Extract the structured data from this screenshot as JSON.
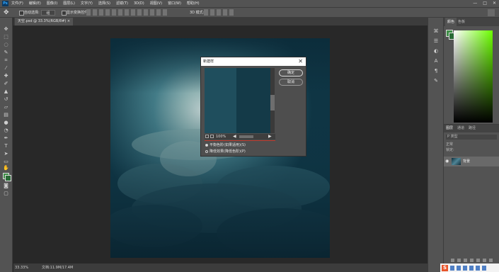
{
  "app": {
    "logo_text": "Ps",
    "menu": [
      "文件(F)",
      "编辑(E)",
      "图像(I)",
      "图层(L)",
      "文字(Y)",
      "选择(S)",
      "滤镜(T)",
      "3D(D)",
      "视图(V)",
      "窗口(W)",
      "帮助(H)"
    ],
    "window_controls": [
      "—",
      "□",
      "✕"
    ]
  },
  "options_bar": {
    "move_icon": "move-tool-icon",
    "auto_select_label": "自动选择:",
    "auto_select_value": "组",
    "show_controls_label": "显示变换控件",
    "mode_3d_label": "3D 模式:"
  },
  "document": {
    "tab_title": "天空.psd @ 33.3%(RGB/8#)"
  },
  "status_bar": {
    "zoom": "33.33%",
    "doc_size": "文档:11.9M/17.4M"
  },
  "color_panel": {
    "tabs": [
      "颜色",
      "色板"
    ],
    "accent_green": "#6cff00",
    "foreground": "#3e8f47",
    "background": "#2a6a36"
  },
  "layers_panel": {
    "tabs": [
      "图层",
      "通道",
      "路径"
    ],
    "filter_placeholder": "P 类型",
    "blend_mode": "正常",
    "lock_label": "锁定:",
    "layer_name": "背景"
  },
  "dialog": {
    "title": "新建样",
    "ok_label": "确定",
    "cancel_label": "取消",
    "zoom": "100%",
    "option1": "平衡色阶(如果适用)(S)",
    "option2": "降低效果(降低色阶)(P)"
  },
  "ime": {
    "logo": "S"
  }
}
